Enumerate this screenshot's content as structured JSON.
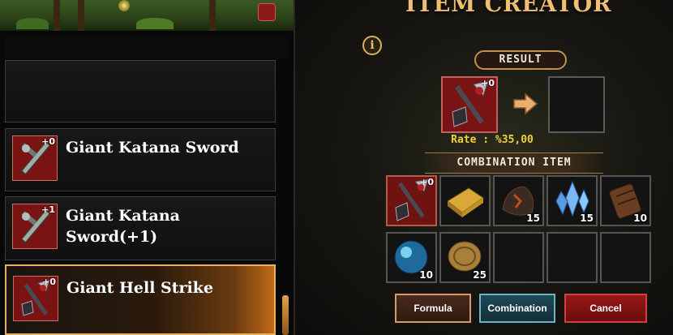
{
  "title": "ITEM CREATOR",
  "info_icon": "i",
  "result_label": "RESULT",
  "rate_text": "Rate : %35,00",
  "combination_label": "COMBINATION ITEM",
  "result_item": {
    "icon": "hell-strike-mace-icon",
    "plus": "+0"
  },
  "item_list": [
    {
      "name": "Giant Katana Sword",
      "plus": "+0",
      "icon": "katana-sword-icon"
    },
    {
      "name": "Giant Katana Sword(+1)",
      "plus": "+1",
      "icon": "katana-sword-icon"
    },
    {
      "name": "Giant Hell Strike",
      "plus": "+0",
      "icon": "hell-strike-mace-icon",
      "selected": true
    }
  ],
  "combination_items": [
    {
      "icon": "hell-strike-mace-icon",
      "plus": "+0",
      "count": ""
    },
    {
      "icon": "gold-bar-icon",
      "count": ""
    },
    {
      "icon": "dark-ore-icon",
      "count": "15"
    },
    {
      "icon": "blue-crystal-icon",
      "count": "15"
    },
    {
      "icon": "leather-scroll-icon",
      "count": "10"
    },
    {
      "icon": "blue-orb-icon",
      "count": "10"
    },
    {
      "icon": "gold-coin-icon",
      "count": "25"
    },
    {
      "icon": "empty",
      "count": ""
    },
    {
      "icon": "empty",
      "count": ""
    },
    {
      "icon": "empty",
      "count": ""
    }
  ],
  "buttons": {
    "formula": "Formula",
    "combination": "Combination",
    "cancel": "Cancel"
  },
  "colors": {
    "title": "#f0c070",
    "rate": "#f0d040",
    "cancel": "#9a1818",
    "combination": "#1e4a56",
    "formula": "#4a2a1c"
  }
}
